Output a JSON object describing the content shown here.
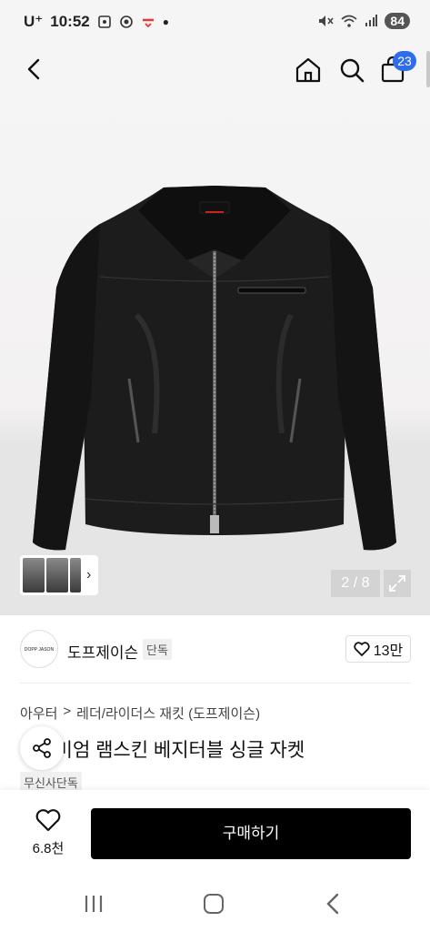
{
  "status_bar": {
    "carrier": "U⁺",
    "time": "10:52",
    "battery": "84"
  },
  "header": {
    "cart_count": "23",
    "icons": [
      "back-arrow-icon",
      "home-icon",
      "search-icon",
      "cart-icon"
    ]
  },
  "gallery": {
    "counter": "2 / 8",
    "thumb_arrow": "›",
    "image_subject": "black leather single jacket"
  },
  "brand": {
    "logo_text": "DOPP JASON",
    "name": "도프제이슨",
    "tag": "단독",
    "likes": "13만"
  },
  "product": {
    "breadcrumb": [
      "아우터",
      ">",
      "레더/라이더스 재킷 (도프제이슨)"
    ],
    "title": "프리미엄 램스킨 베지터블 싱글 자켓",
    "tag": "무신사단독"
  },
  "actions": {
    "wish_count": "6.8천",
    "buy_label": "구매하기"
  },
  "colors": {
    "accent": "#2f6ee8",
    "buy_button": "#000000"
  }
}
